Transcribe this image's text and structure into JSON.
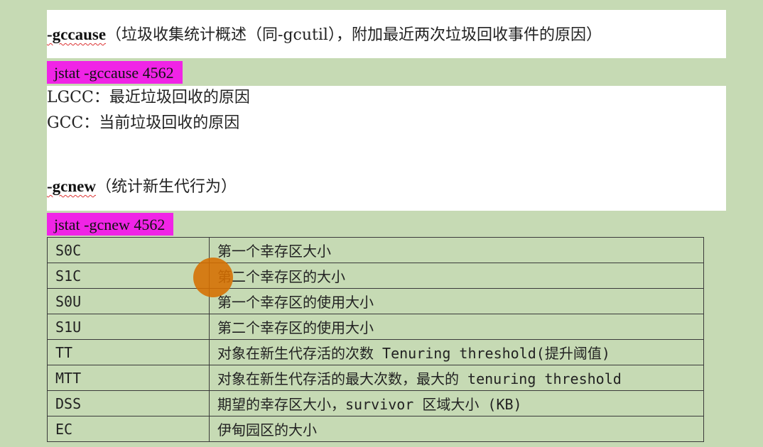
{
  "section1": {
    "option": "-gccause",
    "description": "（垃圾收集统计概述（同-gcutil），附加最近两次垃圾回收事件的原因）",
    "command": "jstat -gccause 4562",
    "lines": [
      "LGCC：最近垃圾回收的原因",
      "GCC：当前垃圾回收的原因"
    ]
  },
  "section2": {
    "option": "-gcnew",
    "description": "（统计新生代行为）",
    "command": "jstat -gcnew 4562"
  },
  "table": {
    "rows": [
      {
        "key": "S0C",
        "desc": "第一个幸存区大小"
      },
      {
        "key": "S1C",
        "desc": "第二个幸存区的大小"
      },
      {
        "key": "S0U",
        "desc": "第一个幸存区的使用大小"
      },
      {
        "key": "S1U",
        "desc": "第二个幸存区的使用大小"
      },
      {
        "key": "TT",
        "desc": "对象在新生代存活的次数 Tenuring threshold(提升阈值)"
      },
      {
        "key": "MTT",
        "desc": "对象在新生代存活的最大次数，最大的 tenuring threshold"
      },
      {
        "key": "DSS",
        "desc": "期望的幸存区大小，survivor 区域大小 (KB)"
      },
      {
        "key": "EC",
        "desc": "伊甸园区的大小"
      }
    ]
  },
  "colors": {
    "page_background": "#c6dab4",
    "highlight": "#f024e6",
    "cursor": "#d66e00"
  }
}
